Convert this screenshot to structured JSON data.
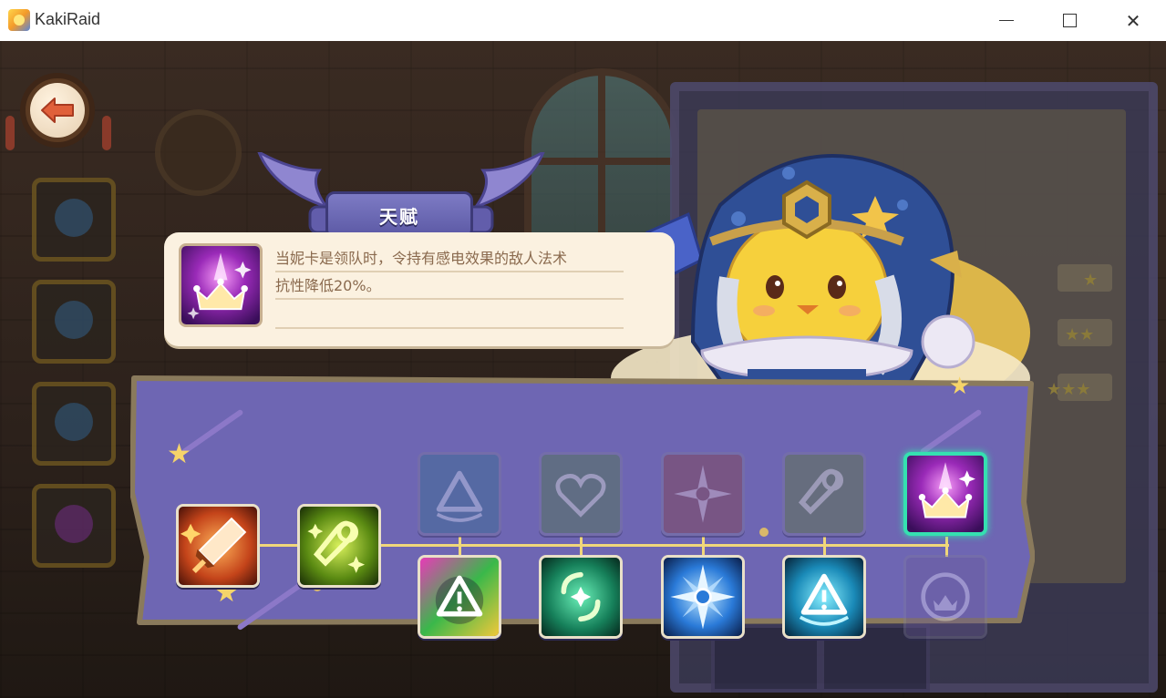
{
  "window": {
    "title": "KakiRaid",
    "minimize_glyph": "",
    "maximize_glyph": "",
    "close_glyph": "✕"
  },
  "header": {
    "back_icon": "back-arrow-icon"
  },
  "talent_tooltip": {
    "title": "天赋",
    "icon": "crown-talent-icon",
    "description_line1": "当妮卡是领队时，令持有感电效果的敌人法术",
    "description_line2": "抗性降低20%。",
    "description_line3": ""
  },
  "talent_tree": {
    "nodes": [
      {
        "id": "sword",
        "icon": "sword-talent-icon",
        "state": "unlocked"
      },
      {
        "id": "flask",
        "icon": "flask-talent-icon",
        "state": "unlocked"
      },
      {
        "id": "warning-top",
        "icon": "warning-talent-icon",
        "state": "locked"
      },
      {
        "id": "heart-top",
        "icon": "heart-talent-icon",
        "state": "locked"
      },
      {
        "id": "star-top",
        "icon": "compass-star-talent-icon",
        "state": "locked"
      },
      {
        "id": "flask-top",
        "icon": "flask-talent-icon",
        "state": "locked"
      },
      {
        "id": "crown-top",
        "icon": "crown-talent-icon",
        "state": "selected"
      },
      {
        "id": "warning-bottom",
        "icon": "warning-rainbow-talent-icon",
        "state": "unlocked"
      },
      {
        "id": "swirl-bottom",
        "icon": "swirl-talent-icon",
        "state": "unlocked"
      },
      {
        "id": "star-bottom",
        "icon": "compass-star-talent-icon",
        "state": "unlocked"
      },
      {
        "id": "warning-blue-bottom",
        "icon": "warning-blue-talent-icon",
        "state": "unlocked"
      },
      {
        "id": "crown-bottom",
        "icon": "crown-ring-talent-icon",
        "state": "locked"
      }
    ]
  },
  "colors": {
    "panel": "#6e66b3",
    "panel_border": "#8a7a5c",
    "selected_border": "#35e0b0",
    "link": "#f0d77a",
    "tooltip_bg": "#fbf1e0",
    "tooltip_text": "#8a6a4e"
  }
}
